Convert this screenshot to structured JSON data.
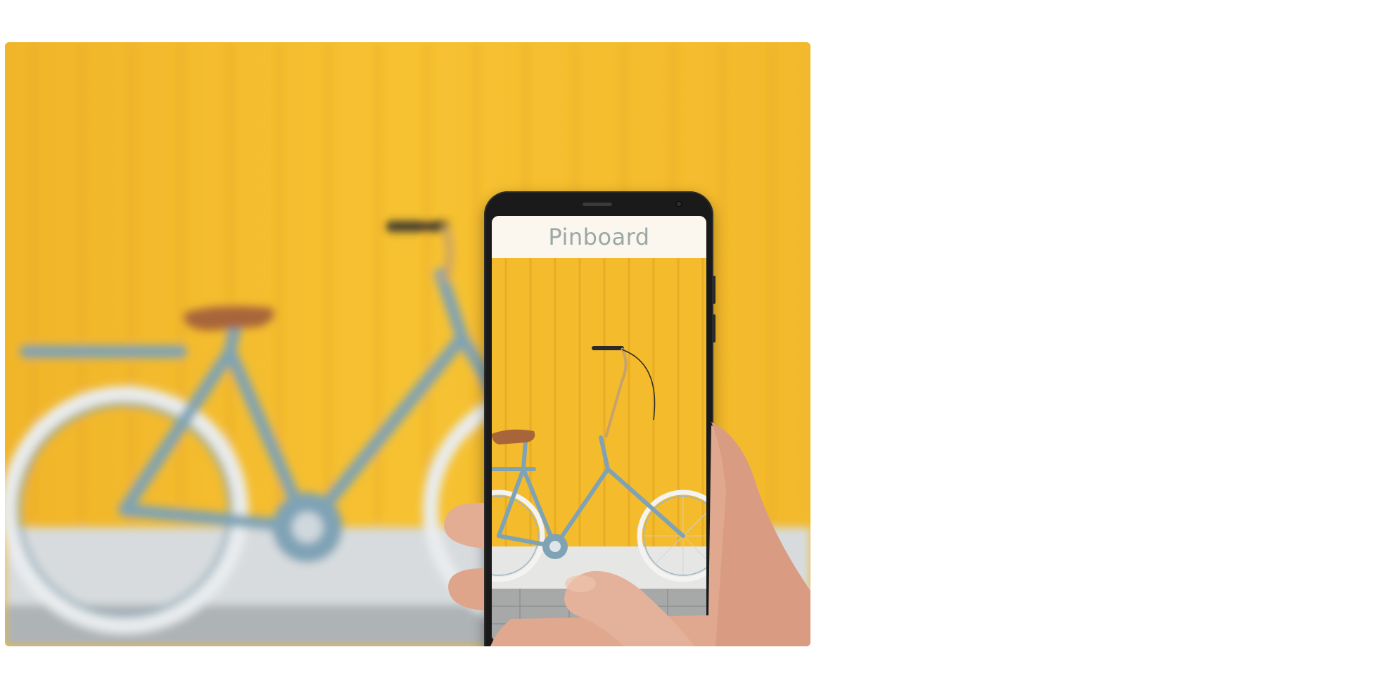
{
  "app": {
    "title": "Pinboard"
  },
  "colors": {
    "wall": "#f4bb2c",
    "bike_frame": "#7fa3b5",
    "saddle": "#a8653a",
    "header_bg": "#fbf6ee"
  }
}
